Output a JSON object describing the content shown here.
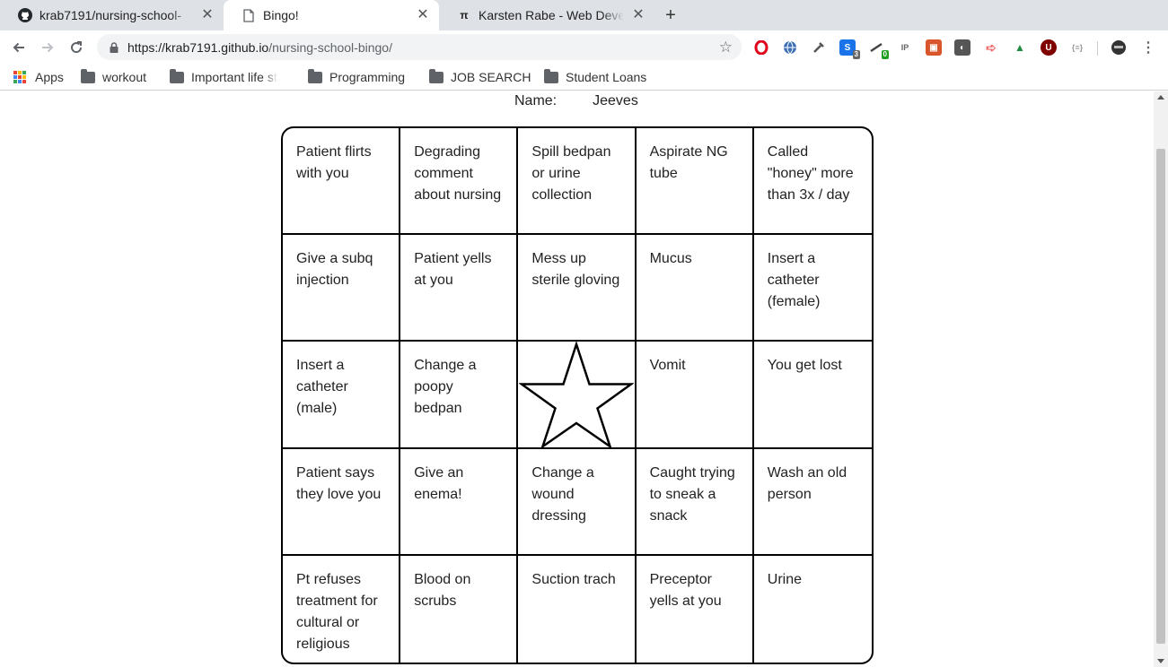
{
  "browser": {
    "tabs": [
      {
        "title": "krab7191/nursing-school-",
        "icon": "github-icon",
        "active": false
      },
      {
        "title": "Bingo!",
        "icon": "page-icon",
        "active": true
      },
      {
        "title": "Karsten Rabe - Web Devel",
        "icon": "pi-icon",
        "active": false
      }
    ],
    "tab_icon_glyph_pi": "π",
    "close_glyph": "✕",
    "new_tab_glyph": "+",
    "url": {
      "host": "https://krab7191.github.io",
      "path": "/nursing-school-bingo/"
    },
    "extension_badges": {
      "ext3": "3",
      "ext4": "0"
    },
    "bookmarks": [
      "Apps",
      "workout",
      "Important life st",
      "Programming",
      "JOB SEARCH",
      "Student Loans"
    ]
  },
  "page": {
    "name_label": "Name:",
    "name_value": "Jeeves",
    "board": [
      [
        "Patient flirts with you",
        "Degrading comment about nursing",
        "Spill bedpan or urine collection",
        "Aspirate NG tube",
        "Called \"honey\" more than 3x / day"
      ],
      [
        "Give a subq injection",
        "Patient yells at you",
        "Mess up sterile gloving",
        "Mucus",
        "Insert a catheter (female)"
      ],
      [
        "Insert a catheter (male)",
        "Change a poopy bedpan",
        "",
        "Vomit",
        "You get lost"
      ],
      [
        "Patient says they love you",
        "Give an enema!",
        "Change a wound dressing",
        "Caught trying to sneak a snack",
        "Wash an old person"
      ],
      [
        "Pt refuses treatment for cultural or religious",
        "Blood on scrubs",
        "Suction trach",
        "Preceptor yells at you",
        "Urine"
      ]
    ],
    "free_space_icon": "star-icon"
  }
}
